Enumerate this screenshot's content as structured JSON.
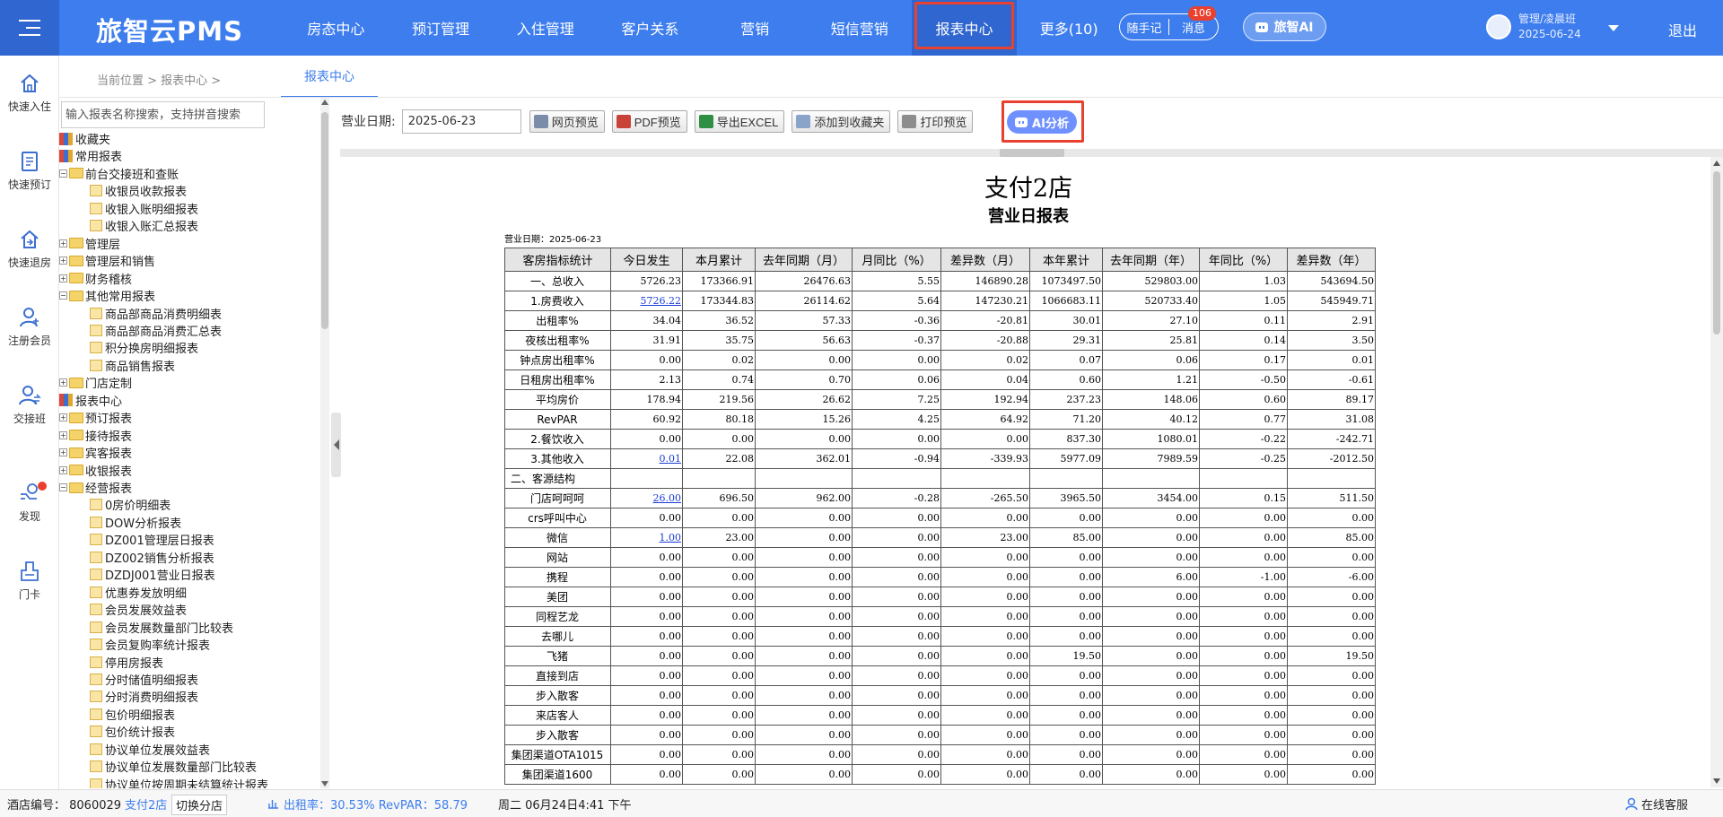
{
  "app": {
    "brand": "旅智云PMS",
    "nav": [
      "房态中心",
      "预订管理",
      "入住管理",
      "客户关系",
      "营销",
      "短信营销",
      "报表中心",
      "更多(10)"
    ],
    "notes_label": "随手记",
    "messages_label": "消息",
    "messages_badge": "106",
    "ai_label": "旅智AI",
    "user_name": "管理/凌晨班",
    "user_date": "2025-06-24",
    "logout": "退出"
  },
  "rail": [
    {
      "label": "快速入住",
      "icon": "home-icon"
    },
    {
      "label": "快速预订",
      "icon": "booking-icon"
    },
    {
      "label": "快速退房",
      "icon": "checkout-icon"
    },
    {
      "label": "注册会员",
      "icon": "user-add-icon"
    },
    {
      "label": "交接班",
      "icon": "handover-icon"
    },
    {
      "label": "发现",
      "icon": "discover-icon"
    },
    {
      "label": "门卡",
      "icon": "card-icon"
    }
  ],
  "breadcrumb": {
    "text": "当前位置  >  报表中心  >"
  },
  "tab": {
    "label": "报表中心"
  },
  "tree": {
    "placeholder": "输入报表名称搜索，支持拼音搜索",
    "items": [
      {
        "label": "收藏夹",
        "type": "book",
        "level": 0
      },
      {
        "label": "常用报表",
        "type": "book",
        "level": 0
      },
      {
        "label": "前台交接班和查账",
        "type": "folder",
        "level": 1,
        "exp": "−"
      },
      {
        "label": "收银员收款报表",
        "type": "doc",
        "level": 2
      },
      {
        "label": "收银入账明细报表",
        "type": "doc",
        "level": 2
      },
      {
        "label": "收银入账汇总报表",
        "type": "doc",
        "level": 2
      },
      {
        "label": "管理层",
        "type": "folder",
        "level": 1,
        "exp": "+"
      },
      {
        "label": "管理层和销售",
        "type": "folder",
        "level": 1,
        "exp": "+"
      },
      {
        "label": "财务稽核",
        "type": "folder",
        "level": 1,
        "exp": "+"
      },
      {
        "label": "其他常用报表",
        "type": "folder",
        "level": 1,
        "exp": "−"
      },
      {
        "label": "商品部商品消费明细表",
        "type": "doc",
        "level": 2
      },
      {
        "label": "商品部商品消费汇总表",
        "type": "doc",
        "level": 2
      },
      {
        "label": "积分换房明细报表",
        "type": "doc",
        "level": 2
      },
      {
        "label": "商品销售报表",
        "type": "doc",
        "level": 2
      },
      {
        "label": "门店定制",
        "type": "folder",
        "level": 1,
        "exp": "+"
      },
      {
        "label": "报表中心",
        "type": "book",
        "level": 0
      },
      {
        "label": "预订报表",
        "type": "folder",
        "level": 1,
        "exp": "+"
      },
      {
        "label": "接待报表",
        "type": "folder",
        "level": 1,
        "exp": "+"
      },
      {
        "label": "宾客报表",
        "type": "folder",
        "level": 1,
        "exp": "+"
      },
      {
        "label": "收银报表",
        "type": "folder",
        "level": 1,
        "exp": "+"
      },
      {
        "label": "经营报表",
        "type": "folder",
        "level": 1,
        "exp": "−"
      },
      {
        "label": "0房价明细表",
        "type": "doc",
        "level": 2
      },
      {
        "label": "DOW分析报表",
        "type": "doc",
        "level": 2
      },
      {
        "label": "DZ001管理层日报表",
        "type": "doc",
        "level": 2
      },
      {
        "label": "DZ002销售分析报表",
        "type": "doc",
        "level": 2
      },
      {
        "label": "DZDJ001营业日报表",
        "type": "doc",
        "level": 2
      },
      {
        "label": "优惠券发放明细",
        "type": "doc",
        "level": 2
      },
      {
        "label": "会员发展效益表",
        "type": "doc",
        "level": 2
      },
      {
        "label": "会员发展数量部门比较表",
        "type": "doc",
        "level": 2
      },
      {
        "label": "会员复购率统计报表",
        "type": "doc",
        "level": 2
      },
      {
        "label": "停用房报表",
        "type": "doc",
        "level": 2
      },
      {
        "label": "分时储值明细报表",
        "type": "doc",
        "level": 2
      },
      {
        "label": "分时消费明细报表",
        "type": "doc",
        "level": 2
      },
      {
        "label": "包价明细报表",
        "type": "doc",
        "level": 2
      },
      {
        "label": "包价统计报表",
        "type": "doc",
        "level": 2
      },
      {
        "label": "协议单位发展效益表",
        "type": "doc",
        "level": 2
      },
      {
        "label": "协议单位发展数量部门比较表",
        "type": "doc",
        "level": 2
      },
      {
        "label": "协议单位按周期未结算统计报表",
        "type": "doc",
        "level": 2
      }
    ]
  },
  "toolbar": {
    "date_label": "营业日期:",
    "date_value": "2025-06-23",
    "buttons": [
      "网页预览",
      "PDF预览",
      "导出EXCEL",
      "添加到收藏夹",
      "打印预览"
    ],
    "ai_button": "AI分析"
  },
  "report": {
    "title": "支付2店",
    "subtitle": "营业日报表",
    "date_line": "营业日期：2025-06-23",
    "headers": [
      "客房指标统计",
      "今日发生",
      "本月累计",
      "去年同期（月）",
      "月同比（%）",
      "差异数（月）",
      "本年累计",
      "去年同期（年）",
      "年同比（%）",
      "差异数（年）"
    ],
    "rows": [
      [
        "一、总收入",
        "5726.23",
        "173366.91",
        "26476.63",
        "5.55",
        "146890.28",
        "1073497.50",
        "529803.00",
        "1.03",
        "543694.50"
      ],
      [
        "1.房费收入",
        "5726.22",
        "173344.83",
        "26114.62",
        "5.64",
        "147230.21",
        "1066683.11",
        "520733.40",
        "1.05",
        "545949.71"
      ],
      [
        "出租率%",
        "34.04",
        "36.52",
        "57.33",
        "-0.36",
        "-20.81",
        "30.01",
        "27.10",
        "0.11",
        "2.91"
      ],
      [
        "夜核出租率%",
        "31.91",
        "35.75",
        "56.63",
        "-0.37",
        "-20.88",
        "29.31",
        "25.81",
        "0.14",
        "3.50"
      ],
      [
        "钟点房出租率%",
        "0.00",
        "0.02",
        "0.00",
        "0.00",
        "0.02",
        "0.07",
        "0.06",
        "0.17",
        "0.01"
      ],
      [
        "日租房出租率%",
        "2.13",
        "0.74",
        "0.70",
        "0.06",
        "0.04",
        "0.60",
        "1.21",
        "-0.50",
        "-0.61"
      ],
      [
        "平均房价",
        "178.94",
        "219.56",
        "26.62",
        "7.25",
        "192.94",
        "237.23",
        "148.06",
        "0.60",
        "89.17"
      ],
      [
        "RevPAR",
        "60.92",
        "80.18",
        "15.26",
        "4.25",
        "64.92",
        "71.20",
        "40.12",
        "0.77",
        "31.08"
      ],
      [
        "2.餐饮收入",
        "0.00",
        "0.00",
        "0.00",
        "0.00",
        "0.00",
        "837.30",
        "1080.01",
        "-0.22",
        "-242.71"
      ],
      [
        "3.其他收入",
        "0.01",
        "22.08",
        "362.01",
        "-0.94",
        "-339.93",
        "5977.09",
        "7989.59",
        "-0.25",
        "-2012.50"
      ],
      [
        "二、客源结构",
        "",
        "",
        "",
        "",
        "",
        "",
        "",
        "",
        ""
      ],
      [
        "门店呵呵呵",
        "26.00",
        "696.50",
        "962.00",
        "-0.28",
        "-265.50",
        "3965.50",
        "3454.00",
        "0.15",
        "511.50"
      ],
      [
        "crs呼叫中心",
        "0.00",
        "0.00",
        "0.00",
        "0.00",
        "0.00",
        "0.00",
        "0.00",
        "0.00",
        "0.00"
      ],
      [
        "微信",
        "1.00",
        "23.00",
        "0.00",
        "0.00",
        "23.00",
        "85.00",
        "0.00",
        "0.00",
        "85.00"
      ],
      [
        "网站",
        "0.00",
        "0.00",
        "0.00",
        "0.00",
        "0.00",
        "0.00",
        "0.00",
        "0.00",
        "0.00"
      ],
      [
        "携程",
        "0.00",
        "0.00",
        "0.00",
        "0.00",
        "0.00",
        "0.00",
        "6.00",
        "-1.00",
        "-6.00"
      ],
      [
        "美团",
        "0.00",
        "0.00",
        "0.00",
        "0.00",
        "0.00",
        "0.00",
        "0.00",
        "0.00",
        "0.00"
      ],
      [
        "同程艺龙",
        "0.00",
        "0.00",
        "0.00",
        "0.00",
        "0.00",
        "0.00",
        "0.00",
        "0.00",
        "0.00"
      ],
      [
        "去哪儿",
        "0.00",
        "0.00",
        "0.00",
        "0.00",
        "0.00",
        "0.00",
        "0.00",
        "0.00",
        "0.00"
      ],
      [
        "飞猪",
        "0.00",
        "0.00",
        "0.00",
        "0.00",
        "0.00",
        "19.50",
        "0.00",
        "0.00",
        "19.50"
      ],
      [
        "直接到店",
        "0.00",
        "0.00",
        "0.00",
        "0.00",
        "0.00",
        "0.00",
        "0.00",
        "0.00",
        "0.00"
      ],
      [
        "步入散客",
        "0.00",
        "0.00",
        "0.00",
        "0.00",
        "0.00",
        "0.00",
        "0.00",
        "0.00",
        "0.00"
      ],
      [
        "来店客人",
        "0.00",
        "0.00",
        "0.00",
        "0.00",
        "0.00",
        "0.00",
        "0.00",
        "0.00",
        "0.00"
      ],
      [
        "步入散客",
        "0.00",
        "0.00",
        "0.00",
        "0.00",
        "0.00",
        "0.00",
        "0.00",
        "0.00",
        "0.00"
      ],
      [
        "集团渠道OTA1015",
        "0.00",
        "0.00",
        "0.00",
        "0.00",
        "0.00",
        "0.00",
        "0.00",
        "0.00",
        "0.00"
      ],
      [
        "集团渠道1600",
        "0.00",
        "0.00",
        "0.00",
        "0.00",
        "0.00",
        "0.00",
        "0.00",
        "0.00",
        "0.00"
      ]
    ],
    "linked_cells": [
      "1-1",
      "9-1",
      "11-1",
      "13-1"
    ],
    "left_aligned_rows": [
      10
    ]
  },
  "status": {
    "hotel_no": "酒店编号：  8060029",
    "store": "支付2店",
    "switch": "切换分店",
    "stats": "出租率：30.53%  RevPAR：58.79",
    "time": "周二 06月24日4:41 下午",
    "service": "在线客服"
  },
  "colors": {
    "primary": "#3d7ded",
    "primary_dark": "#2f66cf",
    "alert": "#e8412f",
    "ai_button": "#6f90ff"
  }
}
